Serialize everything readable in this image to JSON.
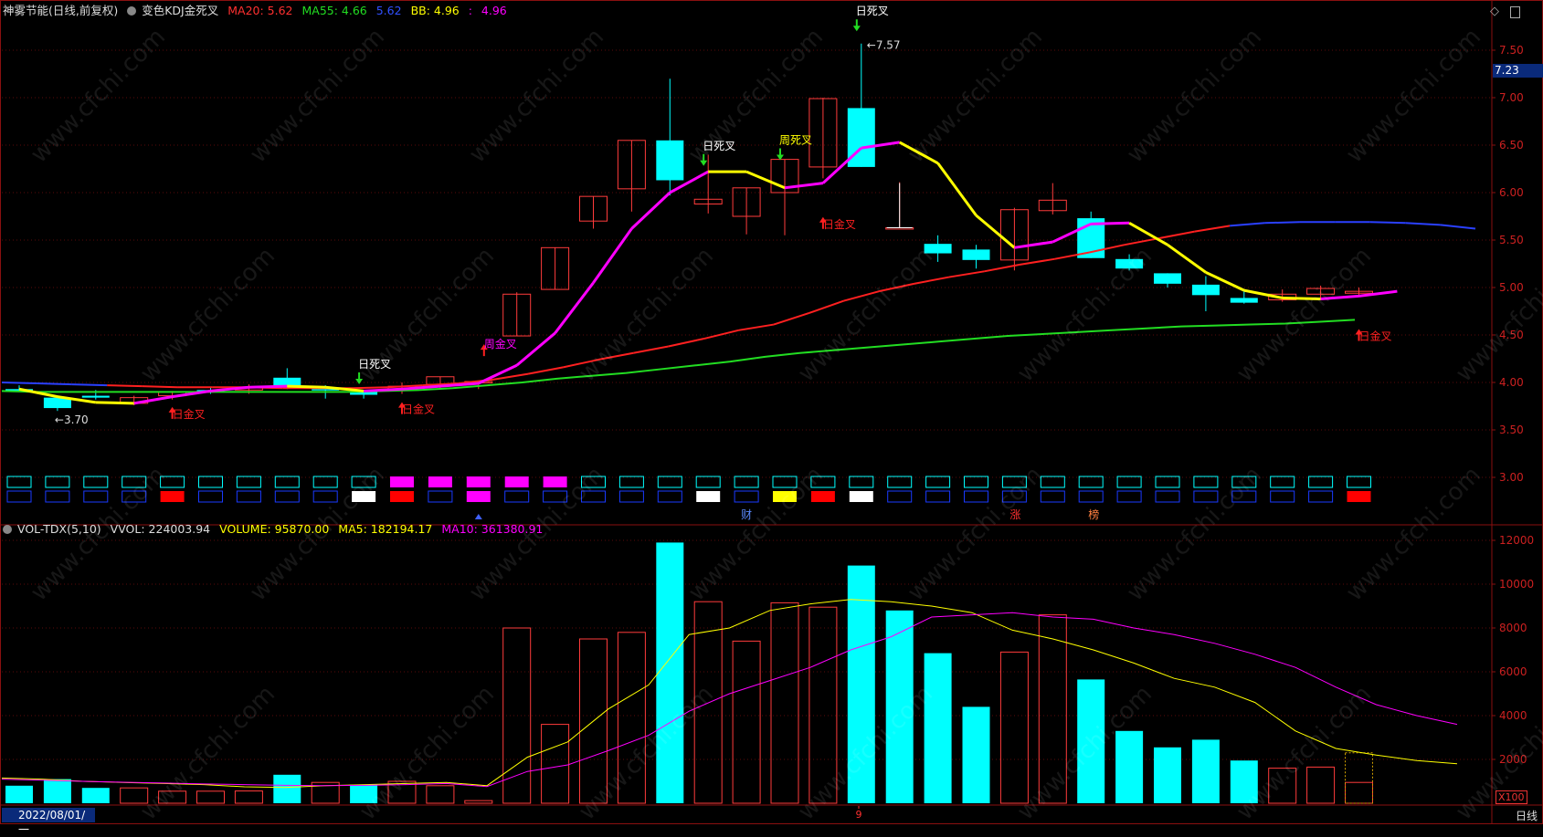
{
  "header": {
    "stock": "神雾节能",
    "mode": "(日线,前复权)",
    "indicator": "变色KDJ金死叉",
    "ma20": "MA20: 5.62",
    "ma55": "MA55: 4.66",
    "ma55b": "5.62",
    "bb": "BB: 4.96",
    "bb2": "4.96"
  },
  "vol_header": {
    "name": "VOL-TDX(5,10)",
    "vvol": "VVOL: 224003.94",
    "volume": "VOLUME: 95870.00",
    "ma5": "MA5: 182194.17",
    "ma10": "MA10: 361380.91"
  },
  "price_axis": [
    "7.50",
    "7.00",
    "6.50",
    "6.00",
    "5.50",
    "5.00",
    "4.50",
    "4.00",
    "3.50",
    "3.00"
  ],
  "vol_axis": [
    "12000",
    "10000",
    "8000",
    "6000",
    "4000",
    "2000"
  ],
  "current_price": "7.23",
  "date_label": "2022/08/01/一",
  "period_label": "日线",
  "volume_scale": "X100",
  "x_marker": "9",
  "watermark": "www.cfchi.com",
  "icons": {
    "top_right_1": "diamond-icon",
    "top_right_2": "window-restore-icon"
  },
  "chart_data": [
    {
      "type": "candlestick",
      "title": "神雾节能 (日线,前复权)",
      "ylim": [
        2.8,
        7.8
      ],
      "candles": [
        {
          "o": 3.93,
          "h": 3.97,
          "l": 3.9,
          "c": 3.9
        },
        {
          "o": 3.84,
          "h": 3.86,
          "l": 3.7,
          "c": 3.73
        },
        {
          "o": 3.86,
          "h": 3.92,
          "l": 3.82,
          "c": 3.84
        },
        {
          "o": 3.78,
          "h": 3.86,
          "l": 3.76,
          "c": 3.84
        },
        {
          "o": 3.86,
          "h": 3.91,
          "l": 3.82,
          "c": 3.9
        },
        {
          "o": 3.92,
          "h": 3.95,
          "l": 3.88,
          "c": 3.9
        },
        {
          "o": 3.92,
          "h": 3.98,
          "l": 3.88,
          "c": 3.95
        },
        {
          "o": 4.05,
          "h": 4.15,
          "l": 3.93,
          "c": 3.95
        },
        {
          "o": 3.93,
          "h": 3.97,
          "l": 3.83,
          "c": 3.92
        },
        {
          "o": 3.9,
          "h": 3.92,
          "l": 3.83,
          "c": 3.87
        },
        {
          "o": 3.92,
          "h": 4.0,
          "l": 3.88,
          "c": 3.96
        },
        {
          "o": 3.98,
          "h": 4.06,
          "l": 3.93,
          "c": 4.06
        },
        {
          "o": 4.0,
          "h": 4.02,
          "l": 3.93,
          "c": 4.01
        },
        {
          "o": 4.49,
          "h": 4.95,
          "l": 4.49,
          "c": 4.93
        },
        {
          "o": 4.98,
          "h": 5.42,
          "l": 4.98,
          "c": 5.42
        },
        {
          "o": 5.7,
          "h": 5.96,
          "l": 5.62,
          "c": 5.96
        },
        {
          "o": 6.04,
          "h": 6.55,
          "l": 5.8,
          "c": 6.55
        },
        {
          "o": 6.55,
          "h": 7.2,
          "l": 5.97,
          "c": 6.13
        },
        {
          "o": 5.88,
          "h": 6.4,
          "l": 5.78,
          "c": 5.93
        },
        {
          "o": 5.75,
          "h": 6.05,
          "l": 5.56,
          "c": 6.05
        },
        {
          "o": 6.0,
          "h": 6.35,
          "l": 5.55,
          "c": 6.35
        },
        {
          "o": 6.27,
          "h": 7.0,
          "l": 6.15,
          "c": 6.99
        },
        {
          "o": 6.89,
          "h": 7.57,
          "l": 6.27,
          "c": 6.27
        },
        {
          "o": 5.63,
          "h": 6.11,
          "l": 5.63,
          "c": 5.63
        },
        {
          "o": 5.46,
          "h": 5.55,
          "l": 5.27,
          "c": 5.36
        },
        {
          "o": 5.4,
          "h": 5.45,
          "l": 5.2,
          "c": 5.29
        },
        {
          "o": 5.29,
          "h": 5.84,
          "l": 5.18,
          "c": 5.82
        },
        {
          "o": 5.81,
          "h": 6.1,
          "l": 5.77,
          "c": 5.92
        },
        {
          "o": 5.73,
          "h": 5.8,
          "l": 5.31,
          "c": 5.31
        },
        {
          "o": 5.3,
          "h": 5.35,
          "l": 5.18,
          "c": 5.2
        },
        {
          "o": 5.15,
          "h": 5.15,
          "l": 5.0,
          "c": 5.04
        },
        {
          "o": 5.03,
          "h": 5.12,
          "l": 4.75,
          "c": 4.92
        },
        {
          "o": 4.89,
          "h": 4.98,
          "l": 4.83,
          "c": 4.84
        },
        {
          "o": 4.87,
          "h": 4.98,
          "l": 4.85,
          "c": 4.93
        },
        {
          "o": 4.93,
          "h": 5.02,
          "l": 4.88,
          "c": 4.99
        },
        {
          "o": 4.94,
          "h": 5.0,
          "l": 4.9,
          "c": 4.96
        }
      ],
      "ma20_line": [
        4.0,
        3.99,
        3.98,
        3.97,
        3.96,
        3.95,
        3.95,
        3.95,
        3.94,
        3.94,
        3.94,
        3.95,
        3.97,
        3.99,
        4.03,
        4.09,
        4.16,
        4.24,
        4.31,
        4.38,
        4.46,
        4.55,
        4.61,
        4.73,
        4.86,
        4.96,
        5.04,
        5.11,
        5.17,
        5.24,
        5.3,
        5.37,
        5.45,
        5.52,
        5.59,
        5.65,
        5.68,
        5.69,
        5.69,
        5.69,
        5.68,
        5.66,
        5.62
      ],
      "ma55_line": [
        3.91,
        3.9,
        3.9,
        3.9,
        3.9,
        3.9,
        3.9,
        3.9,
        3.9,
        3.9,
        3.9,
        3.91,
        3.92,
        3.94,
        3.97,
        4.0,
        4.04,
        4.07,
        4.1,
        4.14,
        4.18,
        4.22,
        4.27,
        4.31,
        4.34,
        4.37,
        4.4,
        4.43,
        4.46,
        4.49,
        4.51,
        4.53,
        4.55,
        4.57,
        4.59,
        4.6,
        4.61,
        4.62,
        4.64,
        4.66
      ],
      "bb_line": [
        3.93,
        3.85,
        3.79,
        3.78,
        3.85,
        3.91,
        3.95,
        3.96,
        3.95,
        3.91,
        3.93,
        3.96,
        3.99,
        4.18,
        4.52,
        5.05,
        5.62,
        6.0,
        6.22,
        6.22,
        6.05,
        6.1,
        6.47,
        6.53,
        6.31,
        5.76,
        5.42,
        5.48,
        5.67,
        5.68,
        5.45,
        5.16,
        4.97,
        4.89,
        4.88,
        4.91,
        4.96
      ],
      "annotations": [
        {
          "text": "3.70",
          "kind": "low"
        },
        {
          "text": "日金叉",
          "kind": "gold"
        },
        {
          "text": "日死叉",
          "kind": "death"
        },
        {
          "text": "日金叉",
          "kind": "gold"
        },
        {
          "text": "周金叉",
          "kind": "week-gold"
        },
        {
          "text": "日死叉",
          "kind": "death"
        },
        {
          "text": "周死叉",
          "kind": "week-death"
        },
        {
          "text": "日金叉",
          "kind": "gold"
        },
        {
          "text": "日死叉",
          "kind": "death"
        },
        {
          "text": "7.57",
          "kind": "high"
        },
        {
          "text": "日金叉",
          "kind": "gold"
        }
      ],
      "kdj_row1": [
        "c",
        "c",
        "c",
        "c",
        "c",
        "c",
        "c",
        "c",
        "c",
        "c",
        "m",
        "m",
        "m",
        "m",
        "m",
        "c",
        "c",
        "c",
        "c",
        "c",
        "c",
        "c",
        "c",
        "c",
        "c",
        "c",
        "c",
        "c",
        "c",
        "c",
        "c",
        "c",
        "c",
        "c",
        "c",
        "c"
      ],
      "kdj_row2": [
        "b",
        "b",
        "b",
        "b",
        "r",
        "b",
        "b",
        "b",
        "b",
        "w",
        "r",
        "b",
        "m",
        "b",
        "b",
        "b",
        "b",
        "b",
        "w",
        "b",
        "y",
        "r",
        "w",
        "b",
        "b",
        "b",
        "b",
        "b",
        "b",
        "b",
        "b",
        "b",
        "b",
        "b",
        "b",
        "r"
      ],
      "event_labels": [
        {
          "text": "财"
        },
        {
          "text": "涨"
        },
        {
          "text": "榜"
        }
      ]
    },
    {
      "type": "bar",
      "title": "VOL-TDX(5,10)",
      "ylim": [
        0,
        12500
      ],
      "values": [
        800,
        1100,
        700,
        700,
        550,
        550,
        560,
        1300,
        950,
        850,
        1000,
        800,
        120,
        8000,
        3600,
        7500,
        7800,
        11900,
        9200,
        7400,
        9150,
        8950,
        10850,
        8800,
        6850,
        4400,
        6900,
        8600,
        5650,
        3300,
        2550,
        2900,
        1950,
        1600,
        1650,
        950
      ],
      "colors": [
        "c",
        "c",
        "c",
        "r",
        "r",
        "r",
        "r",
        "c",
        "r",
        "c",
        "r",
        "r",
        "r",
        "r",
        "r",
        "r",
        "r",
        "c",
        "r",
        "r",
        "r",
        "r",
        "c",
        "c",
        "c",
        "c",
        "r",
        "r",
        "c",
        "c",
        "c",
        "c",
        "c",
        "r",
        "r",
        "r"
      ],
      "ma5": [
        1150,
        1100,
        1000,
        950,
        900,
        850,
        750,
        720,
        800,
        850,
        900,
        950,
        800,
        2100,
        2800,
        4300,
        5400,
        7700,
        8000,
        8800,
        9100,
        9300,
        9200,
        9000,
        8700,
        7900,
        7500,
        7000,
        6400,
        5700,
        5300,
        4600,
        3300,
        2500,
        2200,
        1950,
        1800
      ],
      "ma10": [
        1100,
        1050,
        1000,
        960,
        920,
        880,
        850,
        820,
        800,
        820,
        850,
        900,
        760,
        1450,
        1750,
        2400,
        3100,
        4200,
        5000,
        5600,
        6200,
        7000,
        7600,
        8500,
        8600,
        8700,
        8500,
        8400,
        8000,
        7700,
        7300,
        6800,
        6200,
        5300,
        4500,
        4000,
        3600
      ]
    }
  ]
}
